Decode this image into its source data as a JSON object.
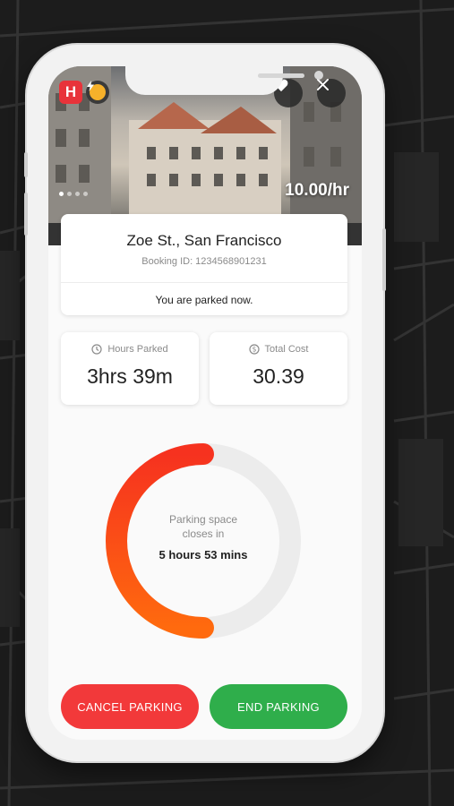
{
  "hero": {
    "badge_letter": "H",
    "rate": "10.00/hr",
    "carousel_total": 4,
    "carousel_active": 0
  },
  "location": {
    "title": "Zoe St., San Francisco",
    "booking_id": "Booking ID:  1234568901231",
    "status": "You are parked now."
  },
  "stats": {
    "hours_label": "Hours Parked",
    "hours_value": "3hrs 39m",
    "cost_label": "Total Cost",
    "cost_value": "30.39"
  },
  "countdown": {
    "line1": "Parking space",
    "line2": "closes in",
    "remaining": "5 hours 53 mins",
    "progress_fraction": 0.5
  },
  "actions": {
    "cancel_label": "CANCEL PARKING",
    "end_label": "END PARKING"
  },
  "colors": {
    "cancel": "#f2393a",
    "end": "#2fae4b",
    "ring_start": "#f6321f",
    "ring_end": "#ff6a0e",
    "brand_badge": "#e8333a"
  }
}
